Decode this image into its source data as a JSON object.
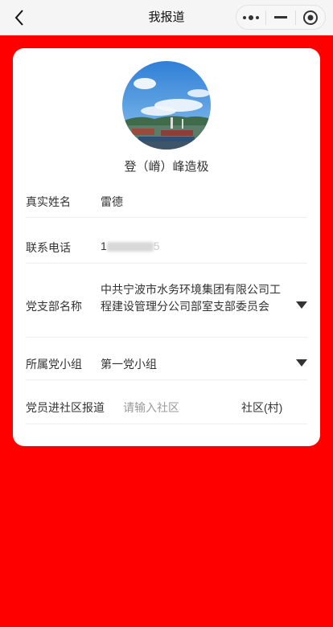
{
  "navbar": {
    "title": "我报道"
  },
  "profile": {
    "name": "登（嵴）峰造极"
  },
  "form": {
    "real_name": {
      "label": "真实姓名",
      "value": "雷德"
    },
    "phone": {
      "label": "联系电话",
      "value_visible_prefix": "1",
      "value_visible_suffix": "5"
    },
    "branch": {
      "label": "党支部名称",
      "value": "中共宁波市水务环境集团有限公司工程建设管理分公司部室支部委员会"
    },
    "group": {
      "label": "所属党小组",
      "value": "第一党小组"
    },
    "community": {
      "label": "党员进社区报道",
      "placeholder": "请输入社区",
      "suffix": "社区(村)"
    }
  },
  "colors": {
    "page_background": "#ff0000",
    "card_background": "#ffffff",
    "navbar_background": "#f5f5f5"
  }
}
